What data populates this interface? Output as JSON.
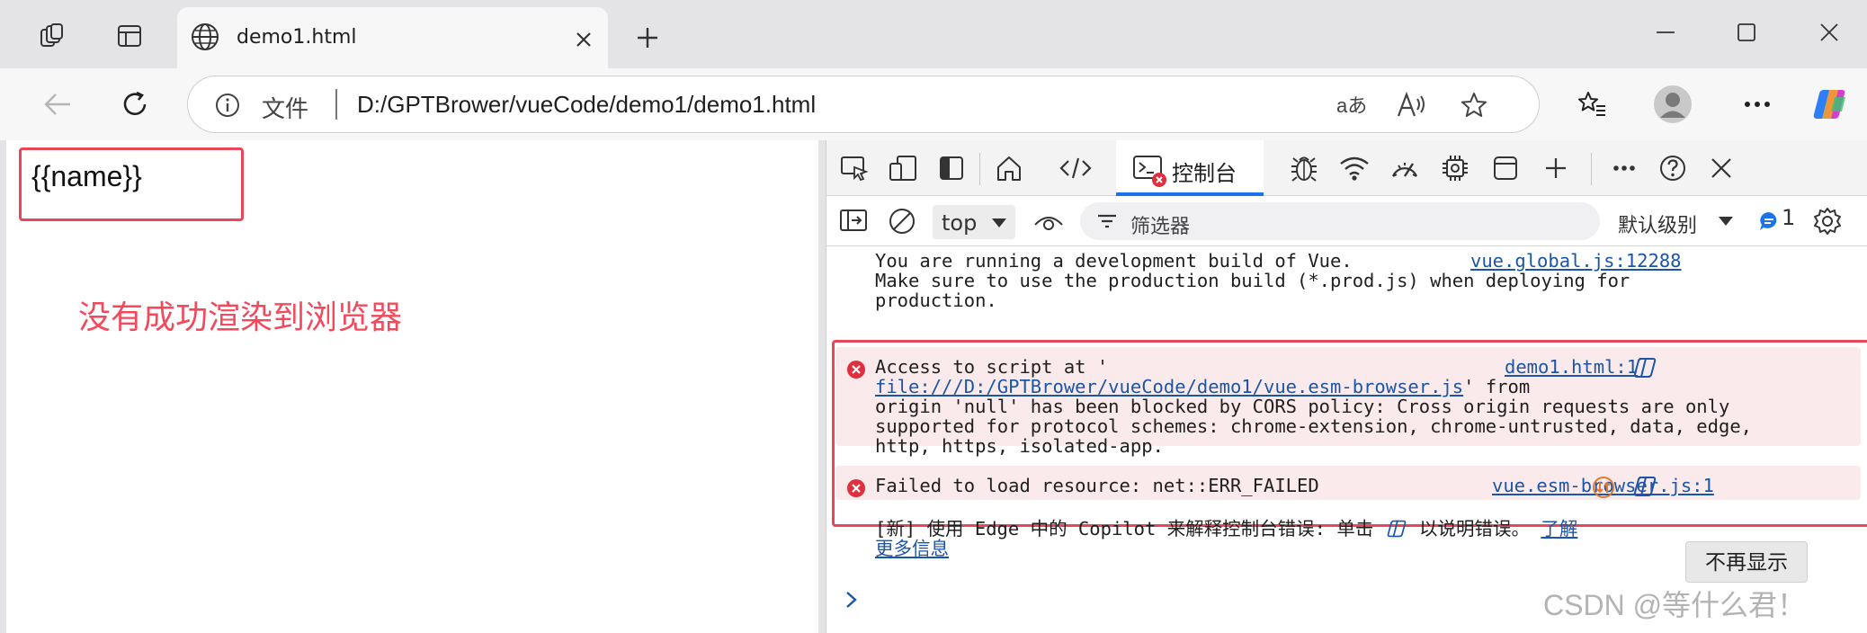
{
  "browser": {
    "tab": {
      "title": "demo1.html",
      "favicon": "globe-icon"
    },
    "toolbar": {
      "scheme_label": "文件",
      "url": "D:/GPTBrower/vueCode/demo1/demo1.html"
    }
  },
  "page": {
    "rendered_text": "{{name}}",
    "annotation": "没有成功渲染到浏览器",
    "annotation_color": "#f24a5c"
  },
  "devtools": {
    "console_tab_label": "控制台",
    "context": "top",
    "filter_placeholder": "筛选器",
    "log_levels": "默认级别",
    "message_count": "1",
    "messages": {
      "vue_info": {
        "lines": [
          "You are running a development build of Vue.",
          "Make sure to use the production build (*.prod.js) when deploying for",
          "production."
        ],
        "source": "vue.global.js:12288"
      },
      "cors_error": {
        "prefix": "Access to script at '",
        "url": "file:///D:/GPTBrower/vueCode/demo1/vue.esm-browser.js",
        "after_url": "' from",
        "lines": [
          "origin 'null' has been blocked by CORS policy: Cross origin requests are only",
          "supported for protocol schemes: chrome-extension, chrome-untrusted, data, edge,",
          "http, https, isolated-app."
        ],
        "source": "demo1.html:1"
      },
      "load_error": {
        "text": "Failed to load resource: net::ERR_FAILED",
        "source": "vue.esm-browser.js:1"
      },
      "copilot_hint": {
        "part1": "[新] 使用 Edge 中的 Copilot 来解释控制台错误: 单击",
        "part2": "以说明错误。",
        "link1": "了解",
        "link2": "更多信息",
        "dismiss_label": "不再显示"
      }
    }
  },
  "watermark": "CSDN @等什么君！",
  "colors": {
    "error_red": "#e0303f",
    "link_blue": "#1a55a8",
    "annotation_box": "#e8475a",
    "devtools_accent": "#1a73e8"
  }
}
